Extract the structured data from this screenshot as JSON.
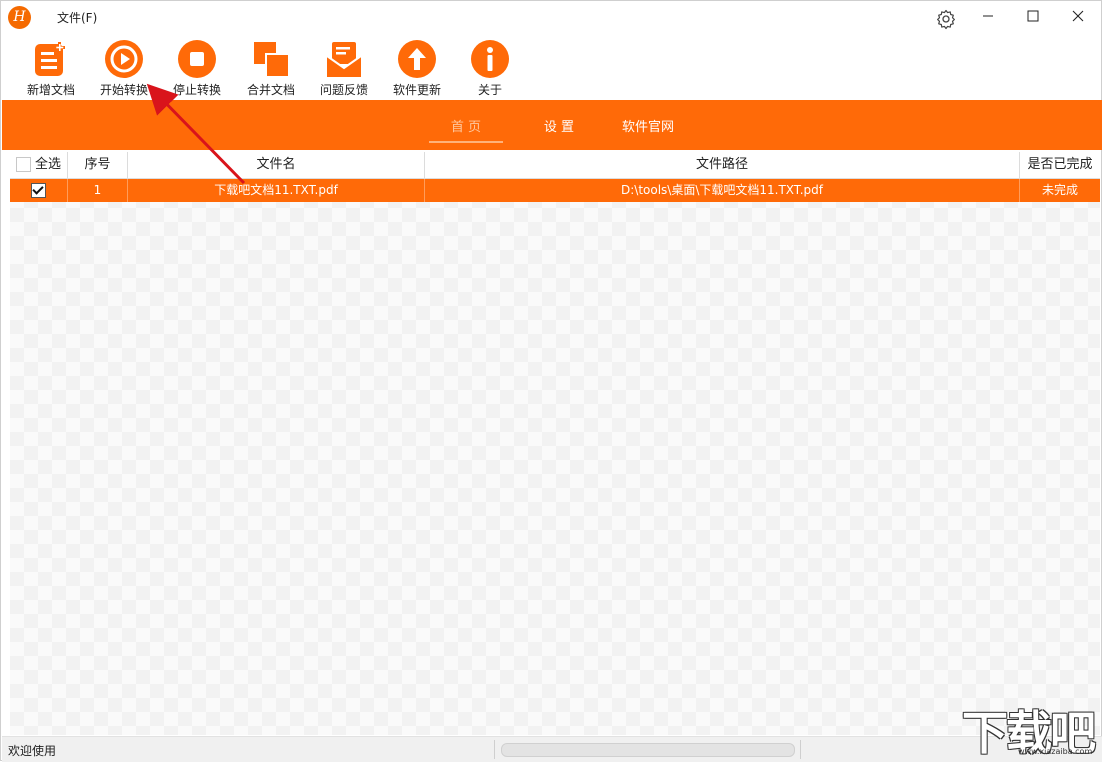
{
  "app": {
    "logo_letter": "H",
    "menu_file": "文件(F)"
  },
  "toolbar": [
    {
      "label": "新增文档",
      "icon": "new-document-icon"
    },
    {
      "label": "开始转换",
      "icon": "play-icon"
    },
    {
      "label": "停止转换",
      "icon": "stop-icon"
    },
    {
      "label": "合并文档",
      "icon": "merge-icon"
    },
    {
      "label": "问题反馈",
      "icon": "feedback-mail-icon"
    },
    {
      "label": "软件更新",
      "icon": "upload-arrow-icon"
    },
    {
      "label": "关于",
      "icon": "info-icon"
    }
  ],
  "nav": {
    "home": "首 页",
    "settings": "设 置",
    "website": "软件官网"
  },
  "table": {
    "headers": {
      "select_all": "全选",
      "index": "序号",
      "filename": "文件名",
      "filepath": "文件路径",
      "done": "是否已完成"
    },
    "rows": [
      {
        "checked": true,
        "index": "1",
        "filename": "下载吧文档11.TXT.pdf",
        "filepath": "D:\\tools\\桌面\\下载吧文档11.TXT.pdf",
        "done": "未完成"
      }
    ]
  },
  "status": {
    "text": "欢迎使用"
  },
  "watermark": {
    "text": "下载吧",
    "sub": "www.xiazaiba.com"
  },
  "colors": {
    "accent": "#ff6a08",
    "arrow": "#d9141b"
  }
}
